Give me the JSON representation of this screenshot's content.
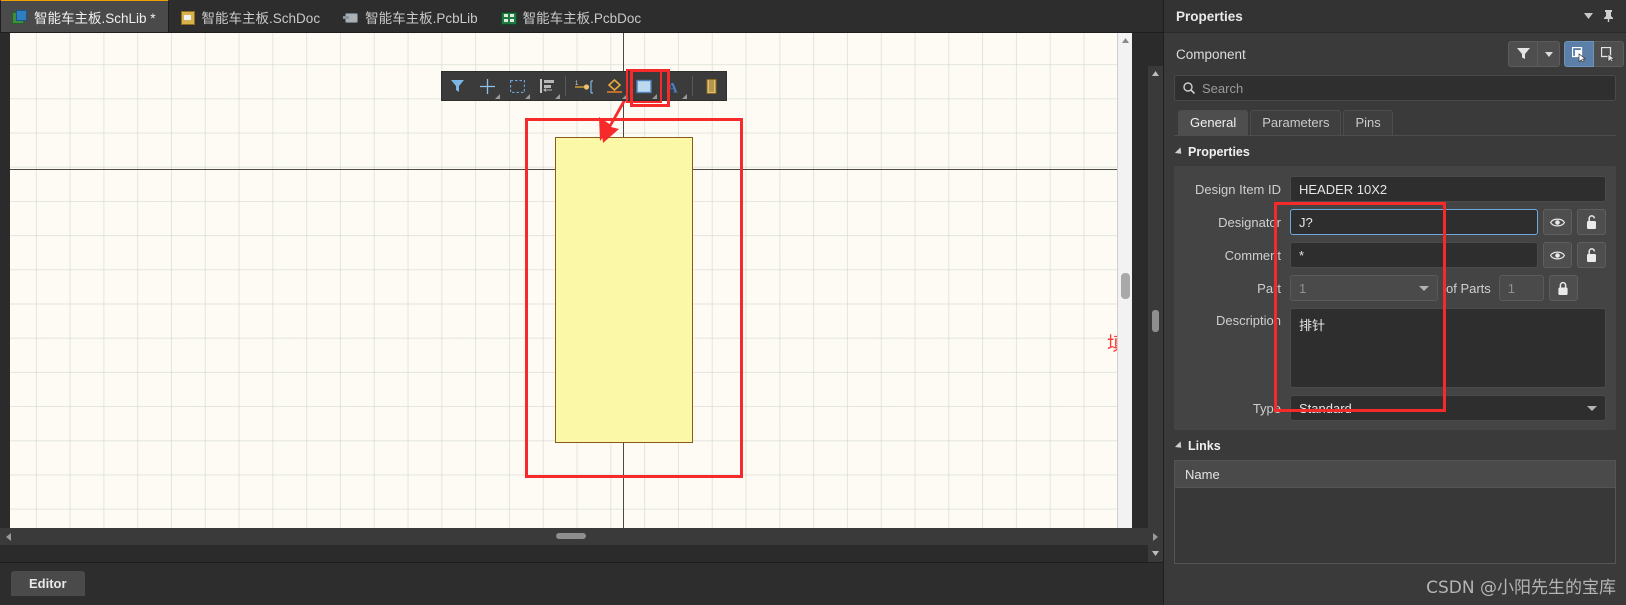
{
  "tabbar": {
    "tabs": [
      {
        "label": "智能车主板.SchLib *",
        "icon": "schlib-icon",
        "active": true
      },
      {
        "label": "智能车主板.SchDoc",
        "icon": "schdoc-icon",
        "active": false
      },
      {
        "label": "智能车主板.PcbLib",
        "icon": "pcblib-icon",
        "active": false
      },
      {
        "label": "智能车主板.PcbDoc",
        "icon": "pcbdoc-icon",
        "active": false
      }
    ]
  },
  "canvas_toolbar": {
    "buttons": [
      {
        "name": "filter-tool",
        "glyph": "filter"
      },
      {
        "name": "crosshair-tool",
        "glyph": "cross"
      },
      {
        "name": "selection-tool",
        "glyph": "marquee"
      },
      {
        "name": "align-tool",
        "glyph": "align"
      },
      {
        "name": "place-pin-tool",
        "glyph": "pin"
      },
      {
        "name": "place-line-tool",
        "glyph": "diamond"
      },
      {
        "name": "place-rectangle-tool",
        "glyph": "rectangle",
        "selected": true
      },
      {
        "name": "place-text-tool",
        "glyph": "text-a"
      },
      {
        "name": "place-image-tool",
        "glyph": "image"
      }
    ]
  },
  "canvas": {
    "annotation_text": "填写基本信息",
    "annotation_color": "#fb3b3b",
    "part_fill_color": "#fbf8a8",
    "part_border_color": "#8a5a1c",
    "background_color": "#fdfbf4"
  },
  "bottom": {
    "editor_tab": "Editor"
  },
  "panel": {
    "title": "Properties",
    "collapse_icon": "chevron-down-icon",
    "pin_icon": "pin-icon",
    "object_type": "Component",
    "filter_icon": "funnel-icon",
    "filter_dropdown_icon": "chevron-down-icon",
    "select_icon": "select-all-icon",
    "deselect_icon": "select-touching-icon",
    "search": {
      "placeholder": "Search",
      "value": "",
      "icon": "search-icon"
    },
    "tabs": [
      {
        "label": "General",
        "active": true
      },
      {
        "label": "Parameters",
        "active": false
      },
      {
        "label": "Pins",
        "active": false
      }
    ],
    "properties_section": {
      "header": "Properties",
      "fields": {
        "design_item_id": {
          "label": "Design Item ID",
          "value": "HEADER 10X2"
        },
        "designator": {
          "label": "Designator",
          "value": "J?",
          "focused": true,
          "visibility_icon": "eye-icon",
          "lock_icon": "unlocked-padlock-icon"
        },
        "comment": {
          "label": "Comment",
          "value": "*",
          "visibility_icon": "eye-icon",
          "lock_icon": "unlocked-padlock-icon"
        },
        "part": {
          "label": "Part",
          "value": "1",
          "disabled": true,
          "of_parts_label": "of Parts",
          "of_parts_value": "1",
          "lock_icon": "locked-padlock-icon",
          "dropdown_icon": "chevron-down-icon"
        },
        "description": {
          "label": "Description",
          "value": "排针"
        },
        "type": {
          "label": "Type",
          "value": "Standard",
          "dropdown_icon": "chevron-down-icon"
        }
      }
    },
    "links_section": {
      "header": "Links",
      "columns": [
        "Name"
      ],
      "rows": []
    },
    "watermark": "CSDN @小阳先生的宝库"
  }
}
